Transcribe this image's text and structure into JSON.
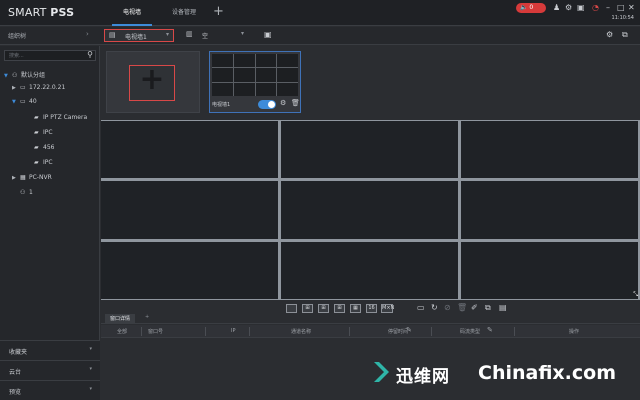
{
  "app": {
    "logo_plain": "SMART ",
    "logo_bold": "PSS"
  },
  "tabs": [
    {
      "label": "电视墙"
    },
    {
      "label": "设备管理"
    }
  ],
  "titlebar": {
    "alarm_count": "0",
    "clock": "11:10:54"
  },
  "toolbar": {
    "tree_label": "组织树",
    "wall_select": "电视墙1",
    "plan_select": "空"
  },
  "sidebar": {
    "search_placeholder": "搜索...",
    "tree": [
      {
        "label": "默认分组"
      },
      {
        "label": "172.22.0.21"
      },
      {
        "label": "40"
      },
      {
        "label": "IP PTZ Camera"
      },
      {
        "label": "IPC"
      },
      {
        "label": "456"
      },
      {
        "label": "IPC"
      },
      {
        "label": "PC-NVR"
      },
      {
        "label": "1"
      }
    ],
    "accordions": [
      {
        "label": "收藏夹"
      },
      {
        "label": "云台"
      },
      {
        "label": "预览"
      }
    ]
  },
  "wall_card": {
    "name": "电视墙1"
  },
  "bottom_tools": {
    "count_16": "16",
    "mxn": "M×N"
  },
  "detail": {
    "tab": "窗口详情",
    "columns": [
      "全部",
      "窗口号",
      "IP",
      "通道名称",
      "停留时间",
      "码流类型",
      "操作"
    ]
  },
  "watermark": {
    "site_cn": "迅维网",
    "site_en": "Chinafix.com"
  }
}
